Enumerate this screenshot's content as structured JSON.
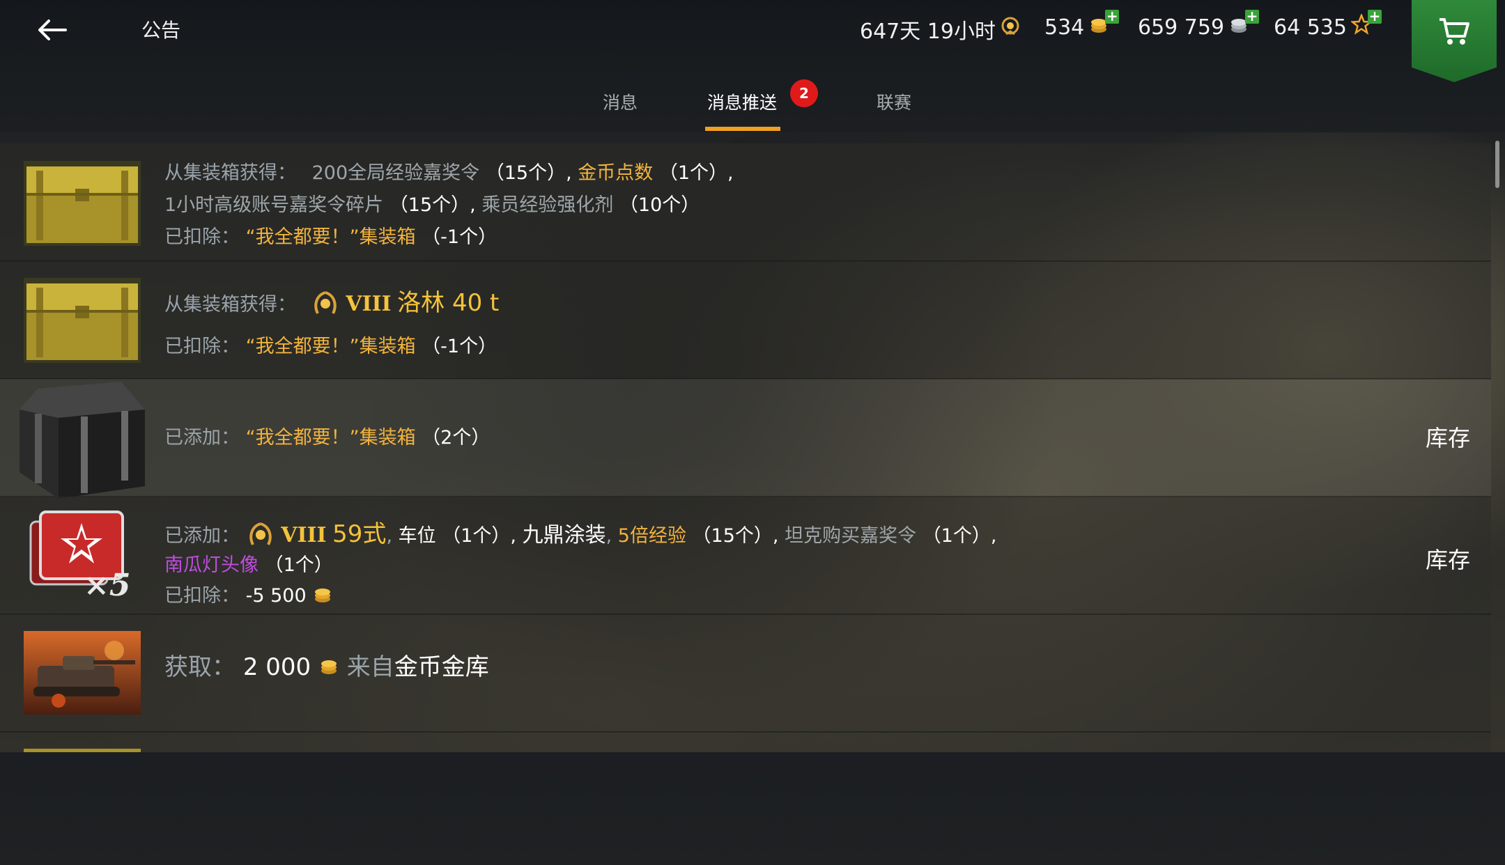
{
  "header": {
    "title": "公告",
    "premium_time": "647天 19小时",
    "gold": "534",
    "credits": "659 759",
    "free_xp": "64 535"
  },
  "tabs": [
    {
      "label": "消息"
    },
    {
      "label": "消息推送",
      "badge": "2"
    },
    {
      "label": "联赛"
    }
  ],
  "messages": [
    {
      "line1_label": "从集装箱获得：",
      "line1_item1": "200全局经验嘉奖令",
      "line1_qty1": "（15个）,",
      "line1_item2": "金币点数",
      "line1_qty2": "（1个）,",
      "line2_item1": "1小时高级账号嘉奖令碎片",
      "line2_qty1": "（15个）,",
      "line2_item2": "乘员经验强化剂",
      "line2_qty2": "（10个）",
      "line3_label": "已扣除：",
      "line3_item": "“我全都要！”集装箱",
      "line3_qty": "（-1个）"
    },
    {
      "line1_label": "从集装箱获得：",
      "tier": "VIII",
      "tank": "洛林 40 t",
      "line2_label": "已扣除：",
      "line2_item": "“我全都要！”集装箱",
      "line2_qty": "（-1个）"
    },
    {
      "line1_label": "已添加：",
      "line1_item": "“我全都要！”集装箱",
      "line1_qty": "（2个）",
      "action": "库存"
    },
    {
      "line1_label": "已添加：",
      "tier": "VIII",
      "tank": "59式",
      "slot": "车位",
      "slot_qty": "（1个）,",
      "camo": "九鼎涂装",
      "xp": "5倍经验",
      "xp_qty": "（15个）,",
      "order": "坦克购买嘉奖令",
      "order_qty": "（1个）,",
      "avatar": "南瓜灯头像",
      "avatar_qty": "（1个）",
      "line3_label": "已扣除：",
      "line3_value": "-5 500",
      "thumb_mult": "×5",
      "action": "库存"
    },
    {
      "label": "获取：",
      "amount": "2 000",
      "from": "来自",
      "source": "金币金库"
    }
  ],
  "colors": {
    "accent_underline": "#f0a020",
    "badge_red": "#e01a1a",
    "gold_text": "#f2b33d",
    "cart_green": "#2f8a3a"
  },
  "icons": [
    "back-arrow-icon",
    "premium-laurel-icon",
    "gold-coin-icon",
    "silver-credit-icon",
    "free-xp-star-icon",
    "plus-icon",
    "cart-icon"
  ]
}
